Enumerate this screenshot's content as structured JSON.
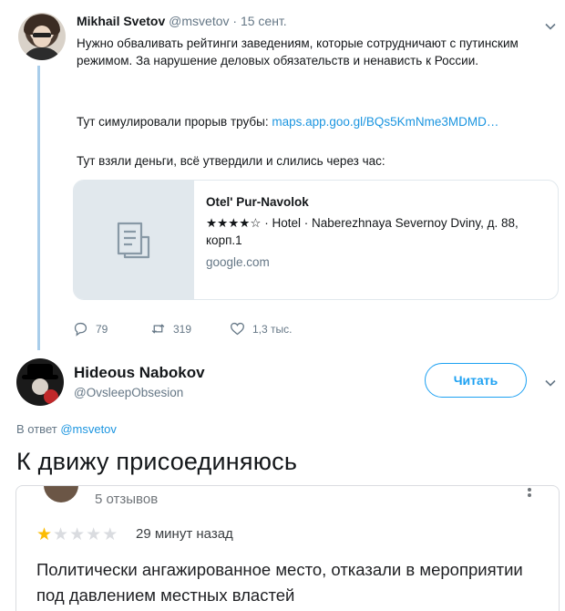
{
  "tweet1": {
    "author_name": "Mikhail Svetov",
    "author_handle": "@msvetov",
    "separator": "·",
    "date": "15 сент.",
    "paragraph1": "Нужно обваливать рейтинги заведениям, которые сотрудничают с путинским режимом. За нарушение деловых обязательств и ненависть к России.",
    "paragraph2_prefix": "Тут симулировали прорыв трубы: ",
    "paragraph2_link": "maps.app.goo.gl/BQs5KmNme3MDMD…",
    "paragraph3": "Тут взяли деньги, всё утвердили и слились через час:",
    "card": {
      "title": "Otel' Pur-Navolok",
      "description": "★★★★☆ · Hotel · Naberezhnaya Severnoy Dviny, д. 88, корп.1",
      "domain": "google.com",
      "thumb_icon": "document-icon"
    },
    "actions": {
      "replies": "79",
      "retweets": "319",
      "likes": "1,3 тыс."
    }
  },
  "tweet2": {
    "author_name": "Hideous Nabokov",
    "author_handle": "@OvsleepObsesion",
    "follow_label": "Читать",
    "reply_prefix": "В ответ ",
    "reply_handle": "@msvetov",
    "text": "К движу присоединяюсь"
  },
  "review": {
    "reviews_count": "5 отзывов",
    "rating": 1,
    "max_rating": 5,
    "time": "29 минут назад",
    "text": "Политически ангажированное место, отказали в мероприятии под давлением местных властей"
  },
  "colors": {
    "link": "#1b95e0",
    "follow": "#1da1f2",
    "thread_line": "#a9cdea",
    "star": "#fbbc04"
  }
}
